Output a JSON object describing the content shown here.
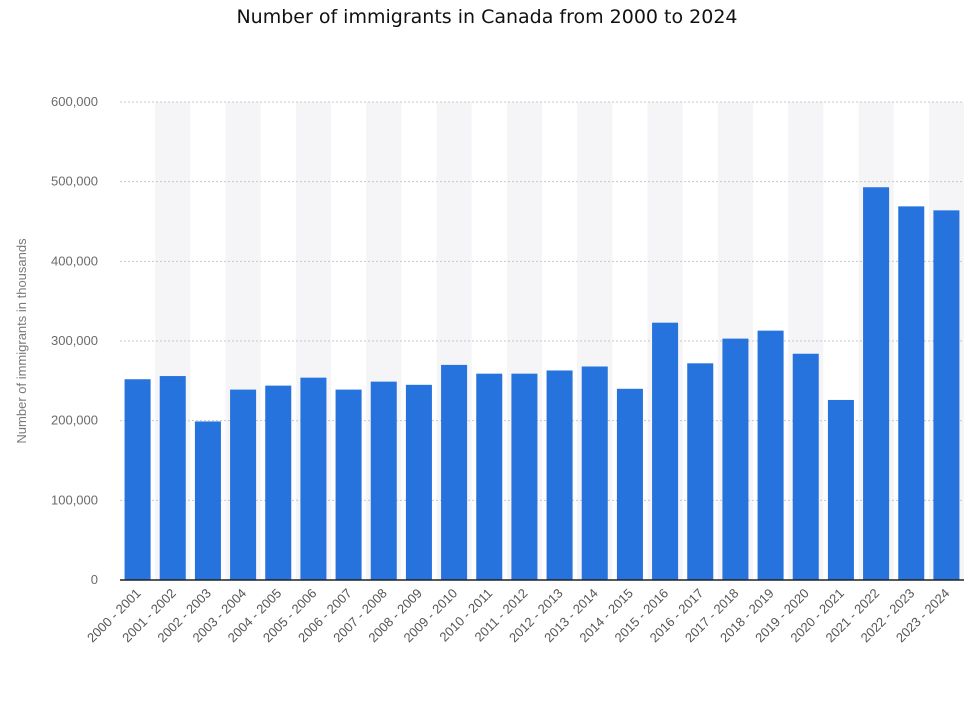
{
  "colors": {
    "bar": "#2673dd",
    "band": "#f5f5f7",
    "grid": "#c8c8c8",
    "axis": "#222222"
  },
  "chart_data": {
    "type": "bar",
    "title": "Number of immigrants in Canada from 2000 to 2024",
    "xlabel": "",
    "ylabel": "Number of immigrants in thousands",
    "ylim": [
      0,
      600000
    ],
    "yticks": [
      0,
      100000,
      200000,
      300000,
      400000,
      500000,
      600000
    ],
    "ytick_labels": [
      "0",
      "100,000",
      "200,000",
      "300,000",
      "400,000",
      "500,000",
      "600,000"
    ],
    "grid": true,
    "categories": [
      "2000 - 2001",
      "2001 - 2002",
      "2002 - 2003",
      "2003 - 2004",
      "2004 - 2005",
      "2005 - 2006",
      "2006 - 2007",
      "2007 - 2008",
      "2008 - 2009",
      "2009 - 2010",
      "2010 - 2011",
      "2011 - 2012",
      "2012 - 2013",
      "2013 - 2014",
      "2014 - 2015",
      "2015 - 2016",
      "2016 - 2017",
      "2017 - 2018",
      "2018 - 2019",
      "2019 - 2020",
      "2020 - 2021",
      "2021 - 2022",
      "2022 - 2023",
      "2023 - 2024"
    ],
    "values": [
      252000,
      256000,
      199000,
      239000,
      244000,
      254000,
      239000,
      249000,
      245000,
      270000,
      259000,
      259000,
      263000,
      268000,
      240000,
      323000,
      272000,
      303000,
      313000,
      284000,
      226000,
      493000,
      469000,
      464000
    ]
  }
}
